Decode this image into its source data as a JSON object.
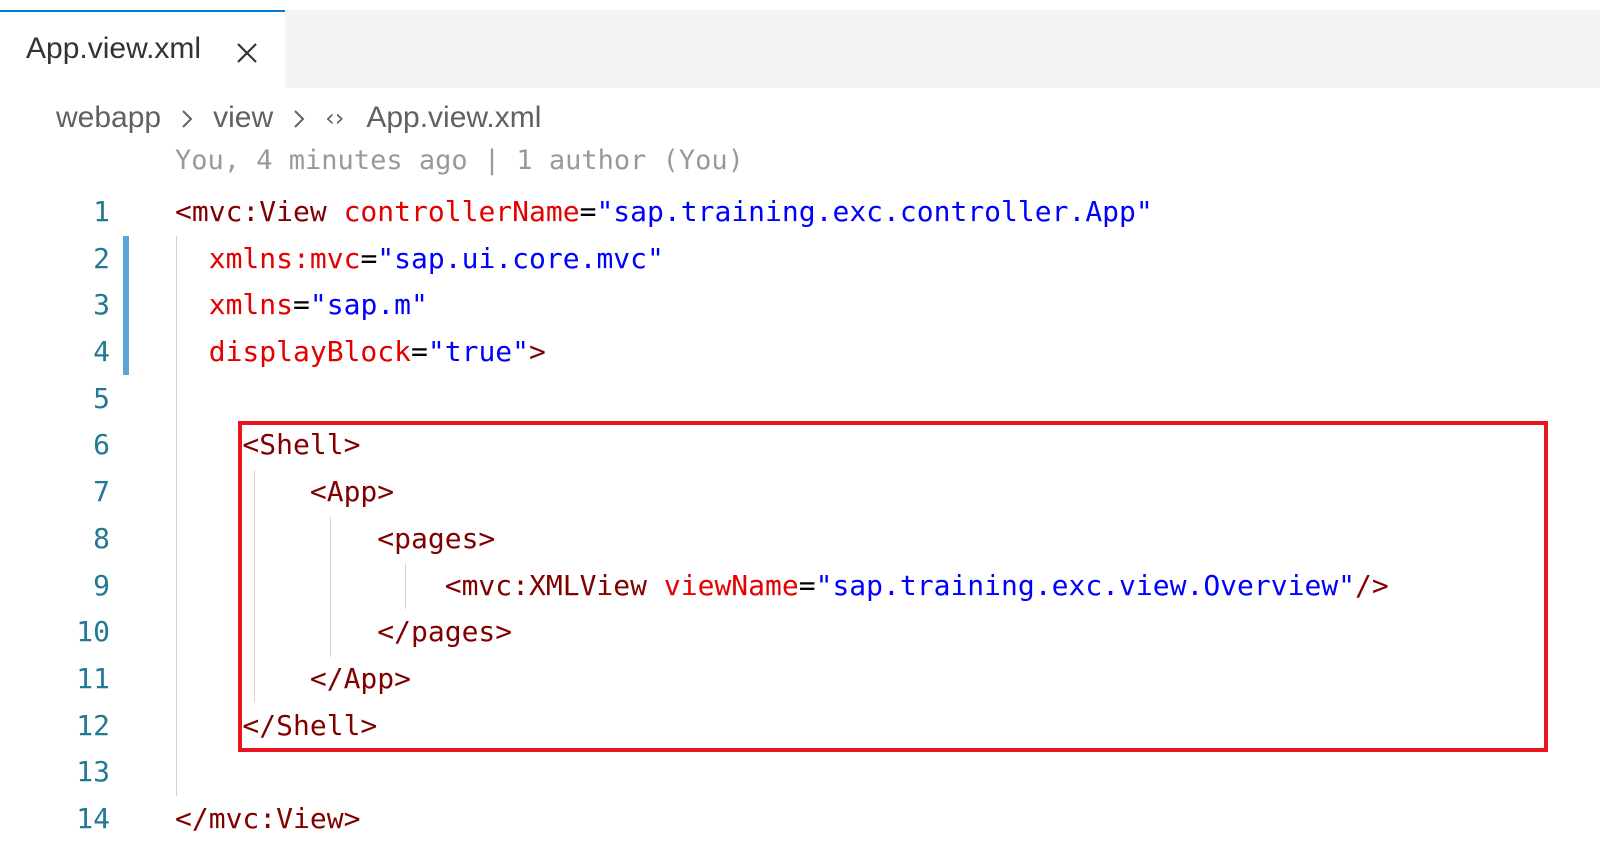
{
  "tab": {
    "label": "App.view.xml",
    "close_icon": "close-icon"
  },
  "breadcrumb": {
    "items": [
      "webapp",
      "view",
      "App.view.xml"
    ],
    "separator_icon": "chevron-right-icon",
    "file_icon": "xml-file-icon"
  },
  "blame": {
    "text": "You, 4 minutes ago | 1 author (You)"
  },
  "editor": {
    "lines": [
      {
        "number": "1",
        "tokens": [
          [
            "tag",
            "<mvc:View "
          ],
          [
            "attr",
            "controllerName"
          ],
          [
            "punct",
            "="
          ],
          [
            "val",
            "\"sap.training.exc.controller.App\""
          ]
        ]
      },
      {
        "number": "2",
        "tokens": [
          [
            "attr",
            "  xmlns:mvc"
          ],
          [
            "punct",
            "="
          ],
          [
            "val",
            "\"sap.ui.core.mvc\""
          ]
        ]
      },
      {
        "number": "3",
        "tokens": [
          [
            "attr",
            "  xmlns"
          ],
          [
            "punct",
            "="
          ],
          [
            "val",
            "\"sap.m\""
          ]
        ]
      },
      {
        "number": "4",
        "tokens": [
          [
            "attr",
            "  displayBlock"
          ],
          [
            "punct",
            "="
          ],
          [
            "val",
            "\"true\""
          ],
          [
            "tag",
            ">"
          ]
        ]
      },
      {
        "number": "5",
        "tokens": []
      },
      {
        "number": "6",
        "tokens": [
          [
            "tag",
            "    <Shell>"
          ]
        ]
      },
      {
        "number": "7",
        "tokens": [
          [
            "tag",
            "        <App>"
          ]
        ]
      },
      {
        "number": "8",
        "tokens": [
          [
            "tag",
            "            <pages>"
          ]
        ]
      },
      {
        "number": "9",
        "tokens": [
          [
            "tag",
            "                <mvc:XMLView "
          ],
          [
            "attr",
            "viewName"
          ],
          [
            "punct",
            "="
          ],
          [
            "val",
            "\"sap.training.exc.view.Overview\""
          ],
          [
            "tag",
            "/>"
          ]
        ]
      },
      {
        "number": "10",
        "tokens": [
          [
            "tag",
            "            </pages>"
          ]
        ]
      },
      {
        "number": "11",
        "tokens": [
          [
            "tag",
            "        </App>"
          ]
        ]
      },
      {
        "number": "12",
        "tokens": [
          [
            "tag",
            "    </Shell>"
          ]
        ]
      },
      {
        "number": "13",
        "tokens": []
      },
      {
        "number": "14",
        "tokens": [
          [
            "tag",
            "</mvc:View>"
          ]
        ]
      }
    ]
  },
  "colors": {
    "tag": "#800000",
    "attribute": "#e50000",
    "value": "#0000ff",
    "line_number": "#237893",
    "highlight_box": "#e8141e",
    "modified_gutter": "#5aa5d8",
    "tab_accent": "#0078d4"
  }
}
